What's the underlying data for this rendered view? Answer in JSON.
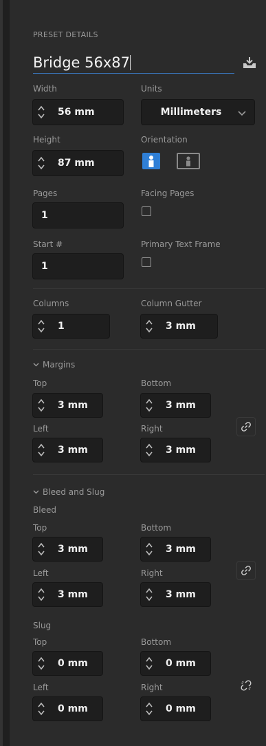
{
  "preset": {
    "heading": "PRESET DETAILS",
    "name": "Bridge 56x87"
  },
  "document": {
    "width_label": "Width",
    "width_value": "56 mm",
    "units_label": "Units",
    "units_value": "Millimeters",
    "height_label": "Height",
    "height_value": "87 mm",
    "orientation_label": "Orientation",
    "orientation_selected": "portrait",
    "pages_label": "Pages",
    "pages_value": "1",
    "facing_pages_label": "Facing Pages",
    "facing_pages_checked": false,
    "start_label": "Start #",
    "start_value": "1",
    "primary_text_frame_label": "Primary Text Frame",
    "primary_text_frame_checked": false
  },
  "columns": {
    "columns_label": "Columns",
    "columns_value": "1",
    "gutter_label": "Column Gutter",
    "gutter_value": "3 mm"
  },
  "margins": {
    "heading": "Margins",
    "top_label": "Top",
    "top_value": "3 mm",
    "bottom_label": "Bottom",
    "bottom_value": "3 mm",
    "left_label": "Left",
    "left_value": "3 mm",
    "right_label": "Right",
    "right_value": "3 mm",
    "linked": true
  },
  "bleed_slug": {
    "heading": "Bleed and Slug",
    "bleed": {
      "heading": "Bleed",
      "top_label": "Top",
      "top_value": "3 mm",
      "bottom_label": "Bottom",
      "bottom_value": "3 mm",
      "left_label": "Left",
      "left_value": "3 mm",
      "right_label": "Right",
      "right_value": "3 mm",
      "linked": true
    },
    "slug": {
      "heading": "Slug",
      "top_label": "Top",
      "top_value": "0 mm",
      "bottom_label": "Bottom",
      "bottom_value": "0 mm",
      "left_label": "Left",
      "left_value": "0 mm",
      "right_label": "Right",
      "right_value": "0 mm",
      "linked": false
    }
  },
  "icons": {
    "save_preset": "save-preset-icon",
    "stepper": "stepper-icon",
    "chevron": "chevron-down-icon",
    "portrait": "portrait-icon",
    "landscape": "landscape-icon",
    "link": "link-icon",
    "unlink": "unlink-icon"
  },
  "colors": {
    "accent": "#2f7fd6",
    "background": "#2b2b2b",
    "field_background": "#1e1e1e"
  }
}
